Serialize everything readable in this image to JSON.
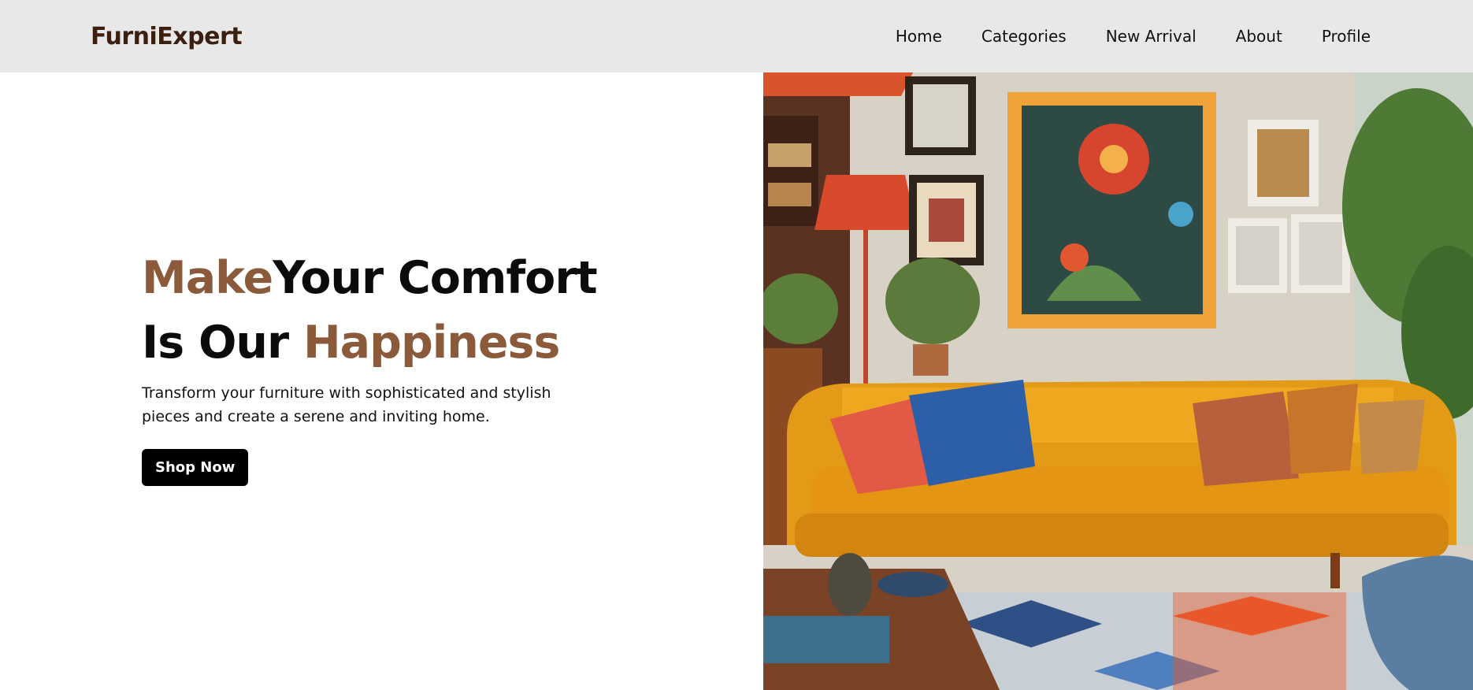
{
  "brand": {
    "name": "FurniExpert"
  },
  "nav": {
    "items": [
      {
        "label": "Home"
      },
      {
        "label": "Categories"
      },
      {
        "label": "New Arrival"
      },
      {
        "label": "About"
      },
      {
        "label": "Profile"
      }
    ]
  },
  "hero": {
    "line1_accent": "Make",
    "line1_rest": "Your Comfort",
    "line2_start": "Is Our ",
    "line2_accent": "Happiness",
    "subtitle": "Transform your furniture with sophisticated and stylish pieces and create a serene and inviting home.",
    "cta_label": "Shop Now"
  },
  "colors": {
    "accent": "#8b5a3a",
    "brand": "#3b1f0f",
    "navbar_bg": "#e8e8e8",
    "button_bg": "#000000"
  }
}
